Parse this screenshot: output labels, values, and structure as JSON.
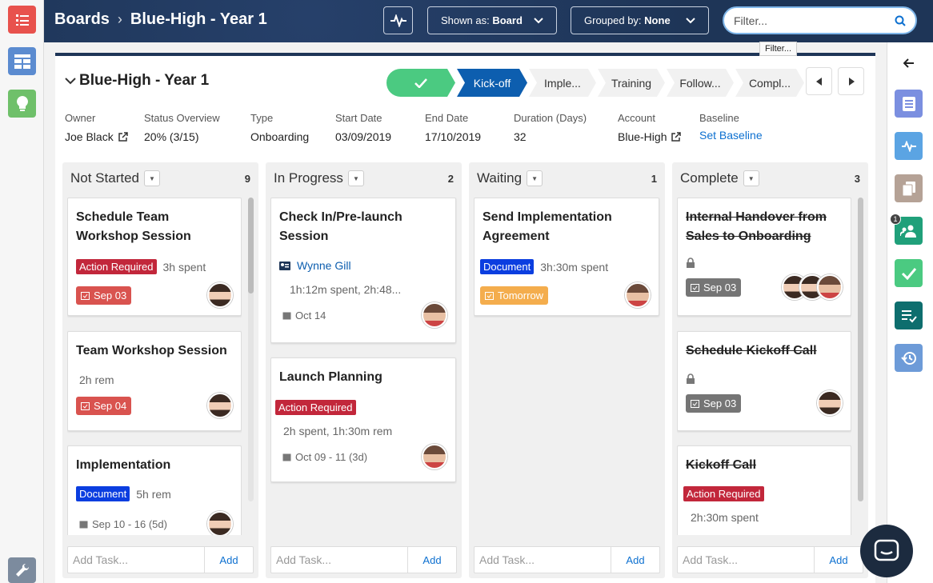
{
  "header": {
    "breadcrumb_root": "Boards",
    "breadcrumb_current": "Blue-High - Year 1",
    "shown_as_label": "Shown as:",
    "shown_as_value": "Board",
    "grouped_by_label": "Grouped by:",
    "grouped_by_value": "None",
    "filter_value": "Filter...",
    "filter_tooltip": "Filter..."
  },
  "project": {
    "title": "Blue-High - Year 1",
    "stages": [
      "",
      "Kick-off",
      "Imple...",
      "Training",
      "Follow...",
      "Compl..."
    ],
    "fields": [
      {
        "label": "Owner",
        "value": "Joe Black"
      },
      {
        "label": "Status Overview",
        "value": "20% (3/15)"
      },
      {
        "label": "Type",
        "value": "Onboarding"
      },
      {
        "label": "Start Date",
        "value": "03/09/2019"
      },
      {
        "label": "End Date",
        "value": "17/10/2019"
      },
      {
        "label": "Duration (Days)",
        "value": "32"
      },
      {
        "label": "Account",
        "value": "Blue-High"
      },
      {
        "label": "Baseline",
        "value": "Set Baseline"
      }
    ]
  },
  "columns": [
    {
      "title": "Not Started",
      "count": "9",
      "cards": [
        {
          "title": "Schedule Team Workshop Session",
          "badge": "Action Required",
          "info": "3h spent",
          "date": "Sep 03"
        },
        {
          "title": "Team Workshop Session",
          "info": "2h rem",
          "date": "Sep 04"
        },
        {
          "title": "Implementation",
          "badge": "Document",
          "info": "5h rem",
          "date": "Sep 10 - 16 (5d)"
        }
      ]
    },
    {
      "title": "In Progress",
      "count": "2",
      "cards": [
        {
          "title": "Check In/Pre-launch Session",
          "assignee": "Wynne Gill",
          "info": "1h:12m spent, 2h:48...",
          "date": "Oct 14"
        },
        {
          "title": "Launch Planning",
          "badge": "Action Required",
          "info": "2h spent, 1h:30m rem",
          "date": "Oct 09 - 11 (3d)"
        }
      ]
    },
    {
      "title": "Waiting",
      "count": "1",
      "cards": [
        {
          "title": "Send Implementation Agreement",
          "badge": "Document",
          "info": "3h:30m spent",
          "date": "Tomorrow"
        }
      ]
    },
    {
      "title": "Complete",
      "count": "3",
      "cards": [
        {
          "title": "Internal Handover from Sales to Onboarding",
          "date": "Sep 03"
        },
        {
          "title": "Schedule Kickoff Call",
          "date": "Sep 03"
        },
        {
          "title": "Kickoff Call",
          "badge": "Action Required",
          "info": "2h:30m spent"
        }
      ]
    }
  ],
  "add_task": {
    "placeholder": "Add Task...",
    "button": "Add"
  },
  "rightrail": {
    "notification_count": "1"
  },
  "colors": {
    "navy": "#1e3557",
    "stage_done": "#4bca81",
    "stage_current": "#0d5eaf",
    "action_required": "#c2273b",
    "document": "#0b3ee0",
    "link": "#0d70d0"
  }
}
